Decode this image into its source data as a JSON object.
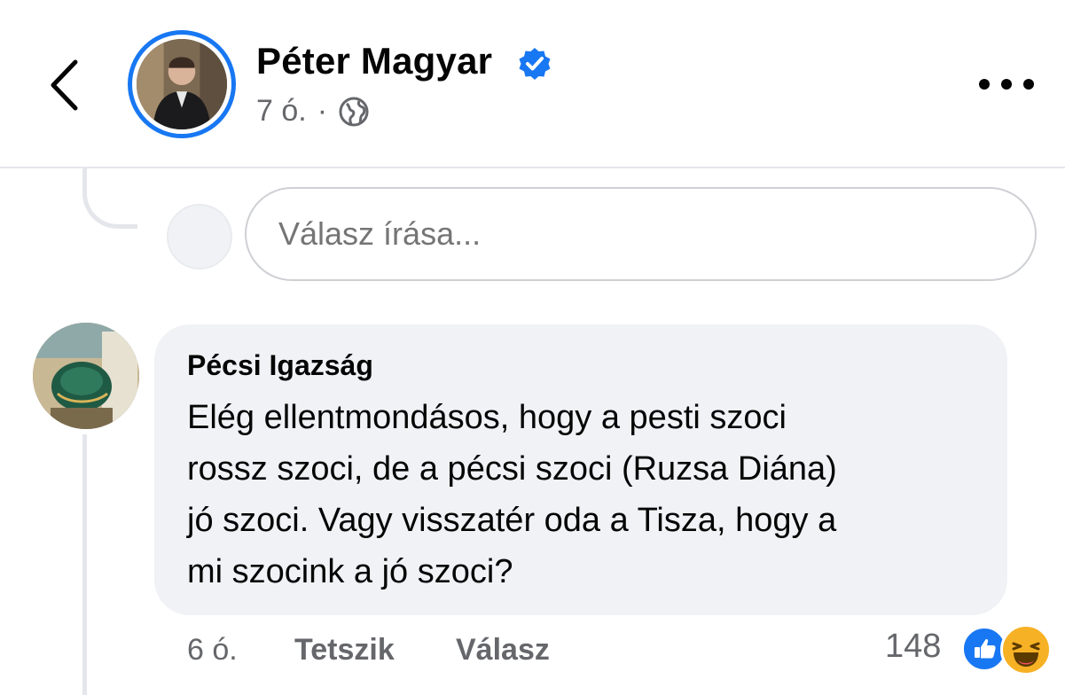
{
  "header": {
    "author_name": "Péter Magyar",
    "verified": true,
    "time": "7 ó.",
    "separator": "·",
    "audience_icon": "globe-icon",
    "back_icon": "chevron-left-icon",
    "more_icon": "more-horizontal-icon"
  },
  "reply_box": {
    "placeholder": "Válasz írása..."
  },
  "comment": {
    "author": "Pécsi Igazság",
    "lines": [
      "Elég ellentmondásos, hogy a pesti szoci",
      "rossz szoci, de a pécsi szoci (Ruzsa Diána)",
      "jó szoci. Vagy visszatér oda a Tisza, hogy a",
      "mi szocink a jó szoci?"
    ],
    "time": "6 ó.",
    "like_label": "Tetszik",
    "reply_label": "Válasz",
    "reaction_count": "148",
    "reactions": [
      "like-icon",
      "haha-icon"
    ]
  },
  "colors": {
    "accent": "#1877f2",
    "muted_text": "#65676b",
    "bubble_bg": "#f0f2f5",
    "haha": "#f7b125"
  }
}
